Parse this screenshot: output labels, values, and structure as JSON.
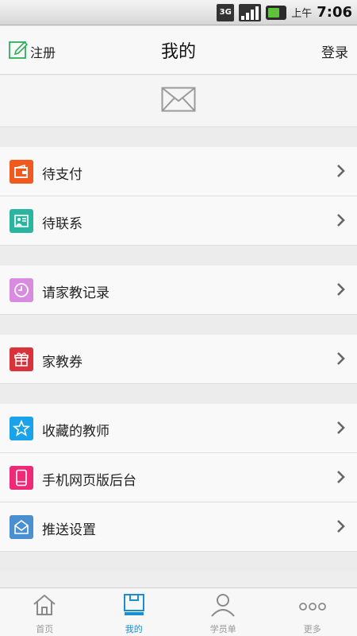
{
  "status_bar": {
    "ampm": "上午",
    "time": "7:06",
    "network": "3G"
  },
  "header": {
    "register_label": "注册",
    "title": "我的",
    "login_label": "登录"
  },
  "menu": {
    "groups": [
      [
        {
          "label": "待支付",
          "icon": "wallet-icon",
          "color": "#f05a1e"
        },
        {
          "label": "待联系",
          "icon": "contact-board-icon",
          "color": "#2bb5a0"
        }
      ],
      [
        {
          "label": "请家教记录",
          "icon": "clock-icon",
          "color": "#d98be0"
        }
      ],
      [
        {
          "label": "家教券",
          "icon": "gift-icon",
          "color": "#d9323a"
        }
      ],
      [
        {
          "label": "收藏的教师",
          "icon": "star-icon",
          "color": "#1aa3e8"
        },
        {
          "label": "手机网页版后台",
          "icon": "tablet-icon",
          "color": "#ee2a78"
        },
        {
          "label": "推送设置",
          "icon": "mail-icon",
          "color": "#4a8fd0"
        }
      ]
    ]
  },
  "bottom_nav": [
    {
      "label": "首页",
      "icon": "home-icon",
      "active": false
    },
    {
      "label": "我的",
      "icon": "profile-box-icon",
      "active": true
    },
    {
      "label": "学员单",
      "icon": "person-icon",
      "active": false
    },
    {
      "label": "更多",
      "icon": "more-icon",
      "active": false
    }
  ],
  "colors": {
    "active_tab": "#1a8fd0",
    "inactive_tab": "#999999"
  }
}
